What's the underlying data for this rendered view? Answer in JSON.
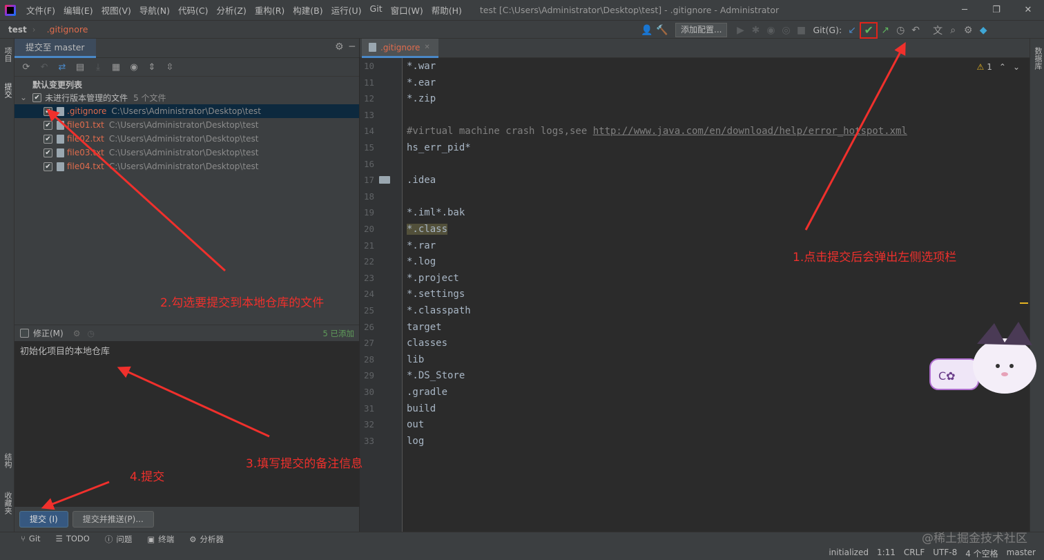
{
  "titlebar": {
    "menu": [
      "文件(F)",
      "编辑(E)",
      "视图(V)",
      "导航(N)",
      "代码(C)",
      "分析(Z)",
      "重构(R)",
      "构建(B)",
      "运行(U)",
      "Git",
      "窗口(W)",
      "帮助(H)"
    ],
    "title": "test [C:\\Users\\Administrator\\Desktop\\test] - .gitignore - Administrator"
  },
  "navbar": {
    "project": "test",
    "file": ".gitignore",
    "add_config": "添加配置...",
    "git_label": "Git(G):"
  },
  "left_strip": {
    "project": "项目",
    "commit": "提交",
    "structure": "结构",
    "favorites": "收藏夹"
  },
  "right_strip": {
    "database": "数据库"
  },
  "commit_panel": {
    "tab": "提交至 master",
    "changelist": "默认变更列表",
    "unversioned_label": "未进行版本管理的文件",
    "unversioned_count": "5 个文件",
    "files": [
      {
        "name": ".gitignore",
        "path": "C:\\Users\\Administrator\\Desktop\\test"
      },
      {
        "name": "file01.txt",
        "path": "C:\\Users\\Administrator\\Desktop\\test"
      },
      {
        "name": "file02.txt",
        "path": "C:\\Users\\Administrator\\Desktop\\test"
      },
      {
        "name": "file03.txt",
        "path": "C:\\Users\\Administrator\\Desktop\\test"
      },
      {
        "name": "file04.txt",
        "path": "C:\\Users\\Administrator\\Desktop\\test"
      }
    ],
    "amend": "修正(M)",
    "added_count": "5 已添加",
    "message": "初始化项目的本地仓库",
    "commit_button": "提交 (I)",
    "commit_push_button": "提交并推送(P)..."
  },
  "editor": {
    "tab": ".gitignore",
    "warnings": "1",
    "lines": [
      {
        "n": "10",
        "text": "*.war"
      },
      {
        "n": "11",
        "text": "*.ear"
      },
      {
        "n": "12",
        "text": "*.zip"
      },
      {
        "n": "13",
        "text": ""
      },
      {
        "n": "14",
        "text": "#virtual machine crash logs,see ",
        "link": "http://www.java.com/en/download/help/error_hotspot.xml"
      },
      {
        "n": "15",
        "text": "hs_err_pid*"
      },
      {
        "n": "16",
        "text": ""
      },
      {
        "n": "17",
        "text": ".idea"
      },
      {
        "n": "18",
        "text": ""
      },
      {
        "n": "19",
        "text": "*.iml*.bak"
      },
      {
        "n": "20",
        "text": "*.class"
      },
      {
        "n": "21",
        "text": "*.rar"
      },
      {
        "n": "22",
        "text": "*.log"
      },
      {
        "n": "23",
        "text": "*.project"
      },
      {
        "n": "24",
        "text": "*.settings"
      },
      {
        "n": "25",
        "text": "*.classpath"
      },
      {
        "n": "26",
        "text": "target"
      },
      {
        "n": "27",
        "text": "classes"
      },
      {
        "n": "28",
        "text": "lib"
      },
      {
        "n": "29",
        "text": "*.DS_Store"
      },
      {
        "n": "30",
        "text": ".gradle"
      },
      {
        "n": "31",
        "text": "build"
      },
      {
        "n": "32",
        "text": "out"
      },
      {
        "n": "33",
        "text": "log"
      }
    ]
  },
  "statusbar": {
    "tools": [
      "Git",
      "TODO",
      "问题",
      "终端",
      "分析器"
    ],
    "right": [
      "initialized",
      "1:11",
      "CRLF",
      "UTF-8",
      "4 个空格",
      "master"
    ]
  },
  "annotations": {
    "a1": "1.点击提交后会弹出左侧选项栏",
    "a2": "2.勾选要提交到本地仓库的文件",
    "a3": "3.填写提交的备注信息",
    "a4": "4.提交"
  },
  "watermark": "@稀土掘金技术社区",
  "colors": {
    "accent": "#4a88c7",
    "annotation": "#f0302c",
    "unversioned_file": "#e06c4d",
    "commit_check": "#5fb85f"
  }
}
